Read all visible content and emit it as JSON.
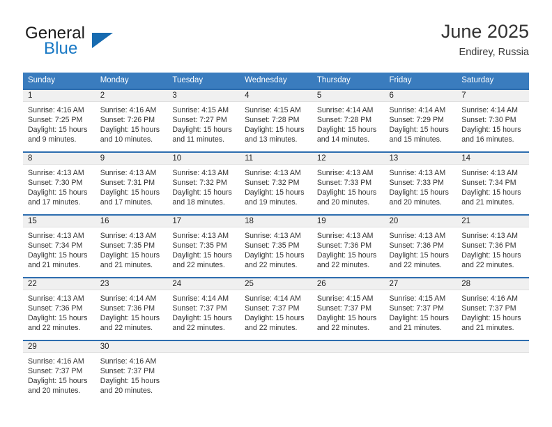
{
  "brand": {
    "name_part1": "General",
    "name_part2": "Blue",
    "logo_icon": "triangle-flag-icon"
  },
  "header": {
    "title": "June 2025",
    "location": "Endirey, Russia"
  },
  "calendar": {
    "weekday_headers": [
      "Sunday",
      "Monday",
      "Tuesday",
      "Wednesday",
      "Thursday",
      "Friday",
      "Saturday"
    ],
    "header_bg": "#3a7cbe",
    "row_rule_color": "#2d6daf",
    "daynum_band_bg": "#f0f0f0",
    "weeks": [
      [
        {
          "day": "1",
          "sunrise": "Sunrise: 4:16 AM",
          "sunset": "Sunset: 7:25 PM",
          "daylight_line1": "Daylight: 15 hours",
          "daylight_line2": "and 9 minutes."
        },
        {
          "day": "2",
          "sunrise": "Sunrise: 4:16 AM",
          "sunset": "Sunset: 7:26 PM",
          "daylight_line1": "Daylight: 15 hours",
          "daylight_line2": "and 10 minutes."
        },
        {
          "day": "3",
          "sunrise": "Sunrise: 4:15 AM",
          "sunset": "Sunset: 7:27 PM",
          "daylight_line1": "Daylight: 15 hours",
          "daylight_line2": "and 11 minutes."
        },
        {
          "day": "4",
          "sunrise": "Sunrise: 4:15 AM",
          "sunset": "Sunset: 7:28 PM",
          "daylight_line1": "Daylight: 15 hours",
          "daylight_line2": "and 13 minutes."
        },
        {
          "day": "5",
          "sunrise": "Sunrise: 4:14 AM",
          "sunset": "Sunset: 7:28 PM",
          "daylight_line1": "Daylight: 15 hours",
          "daylight_line2": "and 14 minutes."
        },
        {
          "day": "6",
          "sunrise": "Sunrise: 4:14 AM",
          "sunset": "Sunset: 7:29 PM",
          "daylight_line1": "Daylight: 15 hours",
          "daylight_line2": "and 15 minutes."
        },
        {
          "day": "7",
          "sunrise": "Sunrise: 4:14 AM",
          "sunset": "Sunset: 7:30 PM",
          "daylight_line1": "Daylight: 15 hours",
          "daylight_line2": "and 16 minutes."
        }
      ],
      [
        {
          "day": "8",
          "sunrise": "Sunrise: 4:13 AM",
          "sunset": "Sunset: 7:30 PM",
          "daylight_line1": "Daylight: 15 hours",
          "daylight_line2": "and 17 minutes."
        },
        {
          "day": "9",
          "sunrise": "Sunrise: 4:13 AM",
          "sunset": "Sunset: 7:31 PM",
          "daylight_line1": "Daylight: 15 hours",
          "daylight_line2": "and 17 minutes."
        },
        {
          "day": "10",
          "sunrise": "Sunrise: 4:13 AM",
          "sunset": "Sunset: 7:32 PM",
          "daylight_line1": "Daylight: 15 hours",
          "daylight_line2": "and 18 minutes."
        },
        {
          "day": "11",
          "sunrise": "Sunrise: 4:13 AM",
          "sunset": "Sunset: 7:32 PM",
          "daylight_line1": "Daylight: 15 hours",
          "daylight_line2": "and 19 minutes."
        },
        {
          "day": "12",
          "sunrise": "Sunrise: 4:13 AM",
          "sunset": "Sunset: 7:33 PM",
          "daylight_line1": "Daylight: 15 hours",
          "daylight_line2": "and 20 minutes."
        },
        {
          "day": "13",
          "sunrise": "Sunrise: 4:13 AM",
          "sunset": "Sunset: 7:33 PM",
          "daylight_line1": "Daylight: 15 hours",
          "daylight_line2": "and 20 minutes."
        },
        {
          "day": "14",
          "sunrise": "Sunrise: 4:13 AM",
          "sunset": "Sunset: 7:34 PM",
          "daylight_line1": "Daylight: 15 hours",
          "daylight_line2": "and 21 minutes."
        }
      ],
      [
        {
          "day": "15",
          "sunrise": "Sunrise: 4:13 AM",
          "sunset": "Sunset: 7:34 PM",
          "daylight_line1": "Daylight: 15 hours",
          "daylight_line2": "and 21 minutes."
        },
        {
          "day": "16",
          "sunrise": "Sunrise: 4:13 AM",
          "sunset": "Sunset: 7:35 PM",
          "daylight_line1": "Daylight: 15 hours",
          "daylight_line2": "and 21 minutes."
        },
        {
          "day": "17",
          "sunrise": "Sunrise: 4:13 AM",
          "sunset": "Sunset: 7:35 PM",
          "daylight_line1": "Daylight: 15 hours",
          "daylight_line2": "and 22 minutes."
        },
        {
          "day": "18",
          "sunrise": "Sunrise: 4:13 AM",
          "sunset": "Sunset: 7:35 PM",
          "daylight_line1": "Daylight: 15 hours",
          "daylight_line2": "and 22 minutes."
        },
        {
          "day": "19",
          "sunrise": "Sunrise: 4:13 AM",
          "sunset": "Sunset: 7:36 PM",
          "daylight_line1": "Daylight: 15 hours",
          "daylight_line2": "and 22 minutes."
        },
        {
          "day": "20",
          "sunrise": "Sunrise: 4:13 AM",
          "sunset": "Sunset: 7:36 PM",
          "daylight_line1": "Daylight: 15 hours",
          "daylight_line2": "and 22 minutes."
        },
        {
          "day": "21",
          "sunrise": "Sunrise: 4:13 AM",
          "sunset": "Sunset: 7:36 PM",
          "daylight_line1": "Daylight: 15 hours",
          "daylight_line2": "and 22 minutes."
        }
      ],
      [
        {
          "day": "22",
          "sunrise": "Sunrise: 4:13 AM",
          "sunset": "Sunset: 7:36 PM",
          "daylight_line1": "Daylight: 15 hours",
          "daylight_line2": "and 22 minutes."
        },
        {
          "day": "23",
          "sunrise": "Sunrise: 4:14 AM",
          "sunset": "Sunset: 7:36 PM",
          "daylight_line1": "Daylight: 15 hours",
          "daylight_line2": "and 22 minutes."
        },
        {
          "day": "24",
          "sunrise": "Sunrise: 4:14 AM",
          "sunset": "Sunset: 7:37 PM",
          "daylight_line1": "Daylight: 15 hours",
          "daylight_line2": "and 22 minutes."
        },
        {
          "day": "25",
          "sunrise": "Sunrise: 4:14 AM",
          "sunset": "Sunset: 7:37 PM",
          "daylight_line1": "Daylight: 15 hours",
          "daylight_line2": "and 22 minutes."
        },
        {
          "day": "26",
          "sunrise": "Sunrise: 4:15 AM",
          "sunset": "Sunset: 7:37 PM",
          "daylight_line1": "Daylight: 15 hours",
          "daylight_line2": "and 22 minutes."
        },
        {
          "day": "27",
          "sunrise": "Sunrise: 4:15 AM",
          "sunset": "Sunset: 7:37 PM",
          "daylight_line1": "Daylight: 15 hours",
          "daylight_line2": "and 21 minutes."
        },
        {
          "day": "28",
          "sunrise": "Sunrise: 4:16 AM",
          "sunset": "Sunset: 7:37 PM",
          "daylight_line1": "Daylight: 15 hours",
          "daylight_line2": "and 21 minutes."
        }
      ],
      [
        {
          "day": "29",
          "sunrise": "Sunrise: 4:16 AM",
          "sunset": "Sunset: 7:37 PM",
          "daylight_line1": "Daylight: 15 hours",
          "daylight_line2": "and 20 minutes."
        },
        {
          "day": "30",
          "sunrise": "Sunrise: 4:16 AM",
          "sunset": "Sunset: 7:37 PM",
          "daylight_line1": "Daylight: 15 hours",
          "daylight_line2": "and 20 minutes."
        },
        {
          "day": "",
          "sunrise": "",
          "sunset": "",
          "daylight_line1": "",
          "daylight_line2": ""
        },
        {
          "day": "",
          "sunrise": "",
          "sunset": "",
          "daylight_line1": "",
          "daylight_line2": ""
        },
        {
          "day": "",
          "sunrise": "",
          "sunset": "",
          "daylight_line1": "",
          "daylight_line2": ""
        },
        {
          "day": "",
          "sunrise": "",
          "sunset": "",
          "daylight_line1": "",
          "daylight_line2": ""
        },
        {
          "day": "",
          "sunrise": "",
          "sunset": "",
          "daylight_line1": "",
          "daylight_line2": ""
        }
      ]
    ]
  }
}
